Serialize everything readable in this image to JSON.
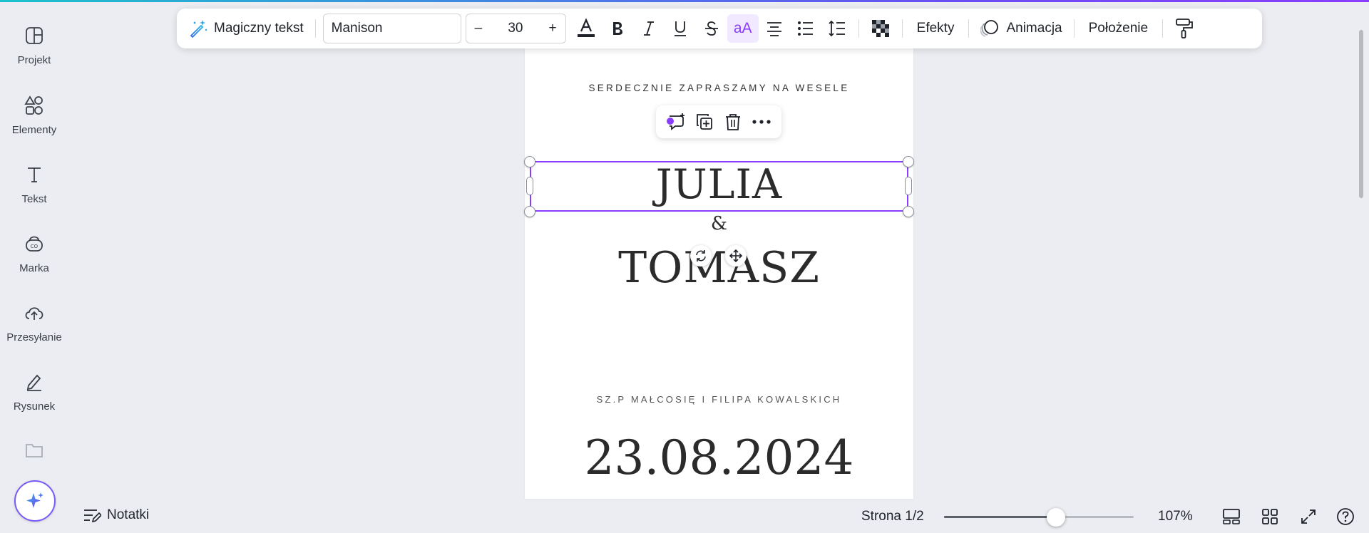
{
  "sidebar": {
    "items": [
      {
        "label": "Projekt",
        "icon": "layout-icon"
      },
      {
        "label": "Elementy",
        "icon": "shapes-icon"
      },
      {
        "label": "Tekst",
        "icon": "text-icon"
      },
      {
        "label": "Marka",
        "icon": "brand-icon"
      },
      {
        "label": "Przesyłanie",
        "icon": "cloud-upload-icon"
      },
      {
        "label": "Rysunek",
        "icon": "draw-icon"
      }
    ]
  },
  "toolbar": {
    "magic_text": "Magiczny tekst",
    "font_name": "Manison",
    "font_size": "30",
    "minus": "–",
    "plus": "+",
    "effects": "Efekty",
    "animation": "Animacja",
    "position": "Położenie",
    "case_label": "aA",
    "text_color": "#1f2329",
    "accent": "#8b3dff"
  },
  "canvas": {
    "invite": "SERDECZNIE ZAPRASZAMY NA WESELE",
    "name1": "JULIA",
    "amp": "&",
    "name2": "TOMASZ",
    "parents": "SZ.P MAŁCOSIĘ I FILIPA KOWALSKICH",
    "date": "23.08.2024"
  },
  "bottombar": {
    "notes": "Notatki",
    "page": "Strona 1/2",
    "zoom": "107%",
    "zoom_fraction": 0.59
  }
}
